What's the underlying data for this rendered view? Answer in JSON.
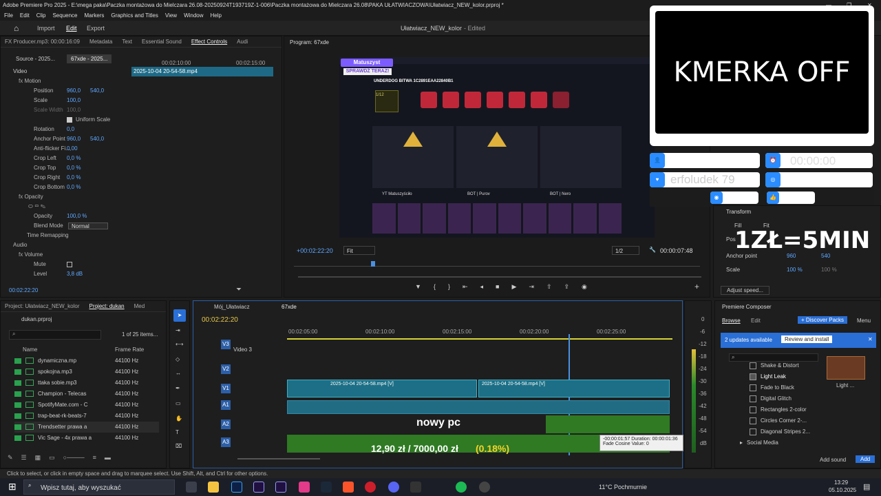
{
  "window": {
    "title": "Adobe Premiere Pro 2025 - E:\\mega paka\\Paczka montażowa do Mielczara 26.08-20250924T193719Z-1-006\\Paczka montażowa do Mielczara 26.08\\PAKA UŁATWIACZOWA\\Ułatwiacz_NEW_kolor.prproj *"
  },
  "menu": [
    "File",
    "Edit",
    "Clip",
    "Sequence",
    "Markers",
    "Graphics and Titles",
    "View",
    "Window",
    "Help"
  ],
  "workspace": {
    "import": "Import",
    "edit": "Edit",
    "export": "Export",
    "project_title": "Ułatwiacz_NEW_kolor",
    "status": "- Edited"
  },
  "fx_producer": "FX Producer.mp3: 00:00:16:09",
  "effect_controls": {
    "tabs": [
      "Metadata",
      "Text",
      "Essential Sound",
      "Effect Controls",
      "Audi"
    ],
    "source_tab": "Source - 2025...",
    "seq_tab": "67xde - 2025...",
    "clip_label": "2025-10-04 20-54-58.mp4",
    "ruler_a": "00:02:10:00",
    "ruler_b": "00:02:15:00",
    "video_label": "Video",
    "audio_label": "Audio",
    "timecode": "00:02:22:20",
    "rows": [
      {
        "name": "Motion",
        "v1": "",
        "v2": ""
      },
      {
        "name": "Position",
        "v1": "960,0",
        "v2": "540,0"
      },
      {
        "name": "Scale",
        "v1": "100,0",
        "v2": ""
      },
      {
        "name": "Scale Width",
        "v1": "100,0",
        "v2": ""
      },
      {
        "name": "Uniform Scale",
        "v1": "",
        "v2": ""
      },
      {
        "name": "Rotation",
        "v1": "0,0",
        "v2": ""
      },
      {
        "name": "Anchor Point",
        "v1": "960,0",
        "v2": "540,0"
      },
      {
        "name": "Anti-flicker Fi...",
        "v1": "0,00",
        "v2": ""
      },
      {
        "name": "Crop Left",
        "v1": "0,0 %",
        "v2": ""
      },
      {
        "name": "Crop Top",
        "v1": "0,0 %",
        "v2": ""
      },
      {
        "name": "Crop Right",
        "v1": "0,0 %",
        "v2": ""
      },
      {
        "name": "Crop Bottom",
        "v1": "0,0 %",
        "v2": ""
      },
      {
        "name": "Opacity",
        "v1": "",
        "v2": ""
      },
      {
        "name": "Opacity",
        "v1": "100,0 %",
        "v2": ""
      },
      {
        "name": "Blend Mode",
        "v1": "Normal",
        "v2": ""
      },
      {
        "name": "Time Remapping",
        "v1": "",
        "v2": ""
      },
      {
        "name": "Volume",
        "v1": "",
        "v2": ""
      },
      {
        "name": "Mute",
        "v1": "",
        "v2": ""
      },
      {
        "name": "Level",
        "v1": "3,8 dB",
        "v2": ""
      }
    ]
  },
  "program": {
    "title": "Program: 67xde",
    "timecode": "+00:02:22:20",
    "fit": "Fit",
    "quality": "1/2",
    "duration": "00:00:07:48",
    "frame": {
      "badge_name": "Matuszyst",
      "badge_sub": "SPRAWDŹ TERAZ!",
      "battle_title": "UNDERDOG BITWA 1C2891EAA22840B1",
      "round": "1/12",
      "p1": "YT Matuszyściło",
      "p2": "BOT | Purov",
      "p3": "BOT | Nero"
    }
  },
  "overlay": {
    "cam_text": "KMERKA OFF",
    "timer": "00:00:00",
    "nick": "erfoludek 79",
    "price": "1ZŁ=5MIN"
  },
  "transform": {
    "title": "Transform",
    "fill": "Fill",
    "fit": "Fit",
    "position_label": "Pos",
    "anchor_label": "Anchor point",
    "anchor_x": "960",
    "anchor_y": "540",
    "scale_label": "Scale",
    "scale1": "100 %",
    "scale2": "100 %",
    "adjust": "Adjust speed..."
  },
  "project": {
    "tabs": [
      "Project: Ułatwiacz_NEW_kolor",
      "Project: dukan",
      "Med"
    ],
    "file": "dukan.prproj",
    "items_count": "1 of 25 items...",
    "col_name": "Name",
    "col_rate": "Frame Rate",
    "rows": [
      {
        "name": "dynamiczna.mp",
        "rate": "44100 Hz"
      },
      {
        "name": "spokojna.mp3",
        "rate": "44100 Hz"
      },
      {
        "name": "ttaka sobie.mp3",
        "rate": "44100 Hz"
      },
      {
        "name": "Champion - Telecas",
        "rate": "44100 Hz"
      },
      {
        "name": "SpotifyMate.com - C",
        "rate": "44100 Hz"
      },
      {
        "name": "trap-beat-rk-beats-7",
        "rate": "44100 Hz"
      },
      {
        "name": "Trendsetter prawa a",
        "rate": "44100 Hz"
      },
      {
        "name": "Vic Sage - 4x prawa a",
        "rate": "44100 Hz"
      }
    ]
  },
  "timeline": {
    "tabs": [
      "Mój_Ułatwiacz",
      "67xde"
    ],
    "timecode": "00:02:22:20",
    "ruler": [
      "00:02:05:00",
      "00:02:10:00",
      "00:02:15:00",
      "00:02:20:00",
      "00:02:25:00"
    ],
    "tracks": [
      "V3",
      "V2",
      "V1",
      "A1",
      "A2",
      "A3"
    ],
    "video3": "Video 3",
    "clip1": "2025-10-04 20-54-58.mp4 [V]",
    "clip2": "2025-10-04 20-54-58.mp4 [V]",
    "caption1": "nowy pc",
    "caption2": "12,90 zł / 7000,00 zł",
    "caption2_pct": "(0.18%)",
    "tooltip1": "-00:00:01:57 Duration: 00:00:01:36",
    "tooltip2": "Fade Cosine Value: 0",
    "meter": [
      "0",
      "-6",
      "-12",
      "-18",
      "-24",
      "-30",
      "-36",
      "-42",
      "-48",
      "-54",
      "dB"
    ]
  },
  "composer": {
    "title": "Premiere Composer",
    "browse": "Browse",
    "edit": "Edit",
    "discover": "+ Discover Packs",
    "menu": "Menu",
    "updates": "2 updates available",
    "review": "Review and install",
    "items": [
      "Shake & Distort",
      "Light Leak",
      "Fade to Black",
      "Digital Glitch",
      "Rectangles 2-color",
      "Circles Corner 2-...",
      "Diagonal Stripes 2...",
      "Social Media"
    ],
    "thumb_label": "Light ...",
    "add_sound": "Add sound",
    "add": "Add"
  },
  "status_bar": "Click to select, or click in empty space and drag to marquee select. Use Shift, Alt, and Ctrl for other options.",
  "taskbar": {
    "search": "Wpisz tutaj, aby wyszukać",
    "weather": "11°C  Pochmurnie",
    "time": "13:29",
    "date": "05.10.2025"
  }
}
